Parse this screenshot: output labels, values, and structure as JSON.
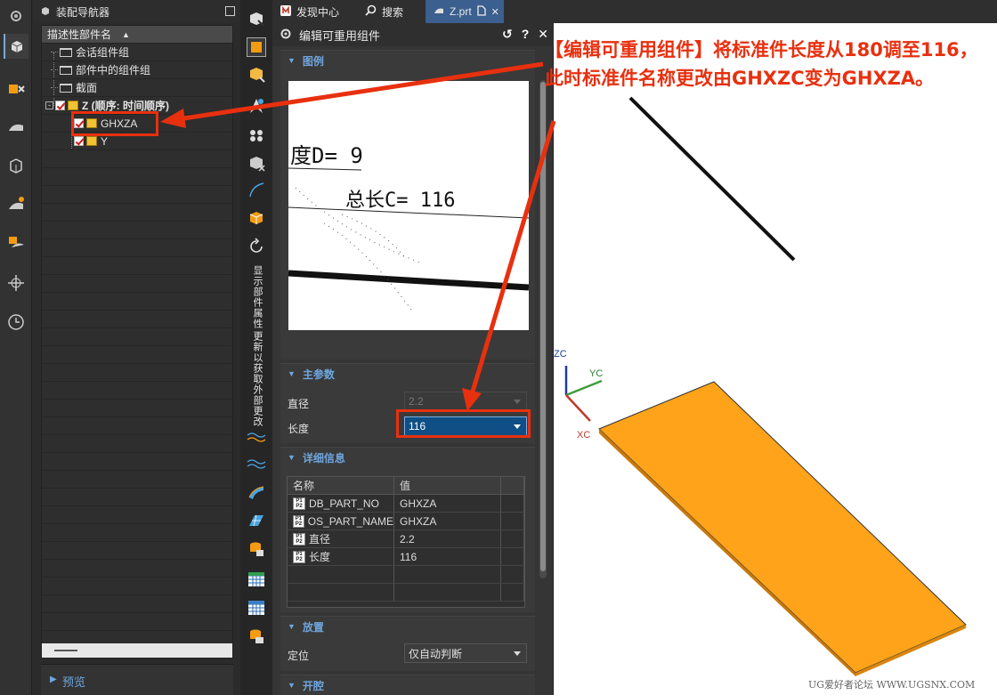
{
  "navigator": {
    "title": "装配导航器",
    "column_header": "描述性部件名",
    "items": [
      {
        "label": "会话组件组"
      },
      {
        "label": "部件中的组件组"
      },
      {
        "label": "截面"
      },
      {
        "label": "Z (顺序: 时间顺序)"
      },
      {
        "label": "GHXZA"
      },
      {
        "label": "Y"
      }
    ],
    "preview_label": "预览"
  },
  "tabs": [
    {
      "label": "发现中心"
    },
    {
      "label": "搜索"
    },
    {
      "label": "Z.prt"
    }
  ],
  "toolbar": {
    "show_part_attributes": "显示部件属性",
    "update_external_changes": "更新以获取外部更改"
  },
  "dialog": {
    "title": "编辑可重用组件",
    "sections": {
      "legend": "图例",
      "main_params": "主参数",
      "details": "详细信息",
      "placement": "放置",
      "slot": "开腔"
    },
    "preview_text": {
      "line1": "度D= 9",
      "line2": "总长C= 116"
    },
    "diameter": {
      "label": "直径",
      "value": "2.2"
    },
    "length": {
      "label": "长度",
      "value": "116"
    },
    "details_table": {
      "headers": [
        "名称",
        "值"
      ],
      "rows": [
        {
          "name": "DB_PART_NO",
          "value": "GHXZA"
        },
        {
          "name": "OS_PART_NAME",
          "value": "GHXZA"
        },
        {
          "name": "直径",
          "value": "2.2"
        },
        {
          "name": "长度",
          "value": "116"
        }
      ]
    },
    "placement": {
      "label": "定位",
      "value": "仅自动判断"
    }
  },
  "axes": {
    "x": "XC",
    "y": "YC",
    "z": "ZC"
  },
  "annotation": "【编辑可重用组件】将标准件长度从180调至116，此时标准件名称更改由GHXZC变为GHXZA。",
  "watermark": "UG爱好者论坛 WWW.UGSNX.COM",
  "colors": {
    "accent": "#6ea6dd",
    "annotation": "#e8300f",
    "plate": "#ffa31a",
    "selection": "#0f4f86"
  }
}
